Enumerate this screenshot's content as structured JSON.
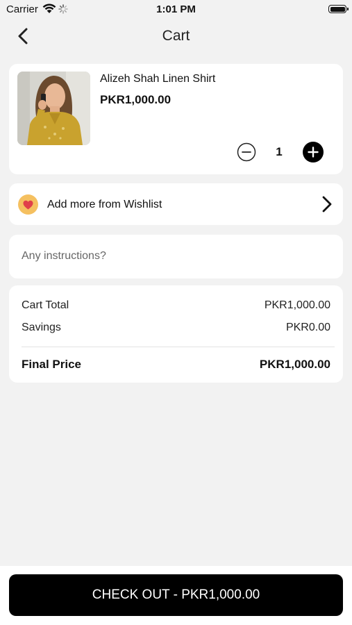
{
  "status_bar": {
    "carrier": "Carrier",
    "time": "1:01 PM"
  },
  "nav": {
    "title": "Cart",
    "back_icon": "chevron-left-icon"
  },
  "cart_item": {
    "name": "Alizeh Shah Linen Shirt",
    "price": "PKR1,000.00",
    "quantity": "1",
    "image_icon": "product-photo"
  },
  "wishlist": {
    "label": "Add more from Wishlist",
    "icon": "heart-icon",
    "chevron_icon": "chevron-right-icon",
    "badge_color": "#f5c060",
    "heart_color": "#e0404a"
  },
  "instructions": {
    "placeholder": "Any instructions?",
    "value": ""
  },
  "totals": {
    "cart_total_label": "Cart Total",
    "cart_total_value": "PKR1,000.00",
    "savings_label": "Savings",
    "savings_value": "PKR0.00",
    "final_label": "Final Price",
    "final_value": "PKR1,000.00"
  },
  "checkout": {
    "label": "CHECK OUT - PKR1,000.00"
  },
  "colors": {
    "background": "#f2f2f2",
    "card": "#ffffff",
    "primary": "#000000"
  }
}
